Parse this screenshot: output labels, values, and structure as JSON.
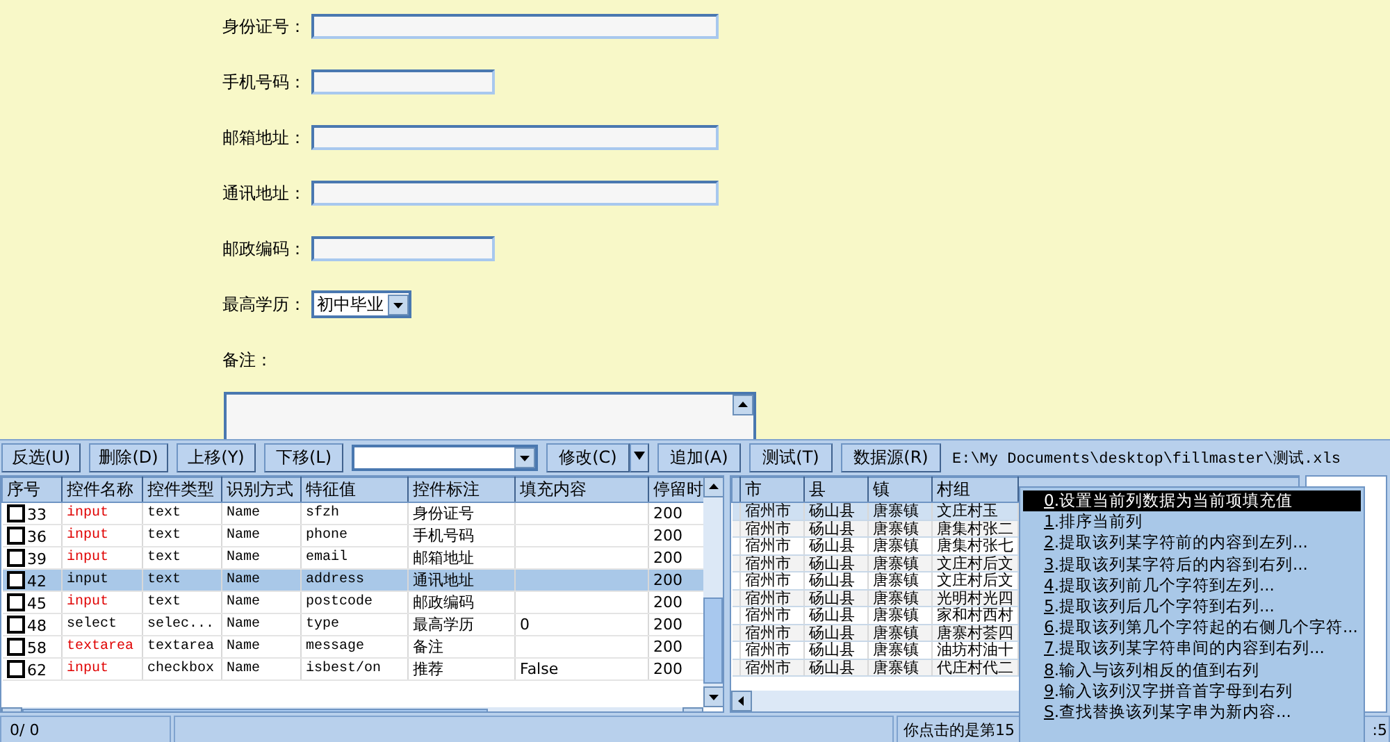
{
  "form": {
    "fields": [
      {
        "label": "身份证号：",
        "kind": "long_text"
      },
      {
        "label": "手机号码：",
        "kind": "short_text"
      },
      {
        "label": "邮箱地址：",
        "kind": "long_text"
      },
      {
        "label": "通讯地址：",
        "kind": "long_text"
      },
      {
        "label": "邮政编码：",
        "kind": "short_text"
      },
      {
        "label": "最高学历：",
        "kind": "select",
        "value": "初中毕业"
      },
      {
        "label": "备注：",
        "kind": "textarea"
      }
    ]
  },
  "toolbar": {
    "buttons": [
      {
        "text": "反选(U)"
      },
      {
        "text": "删除(D)"
      },
      {
        "text": "上移(Y)"
      },
      {
        "text": "下移(L)"
      }
    ],
    "button2": [
      {
        "text": "修改(C)",
        "dropdown": true
      },
      {
        "text": "追加(A)",
        "dropdown": false
      },
      {
        "text": "测试(T)",
        "dropdown": false
      },
      {
        "text": "数据源(R)",
        "dropdown": false
      }
    ],
    "path": "E:\\My Documents\\desktop\\fillmaster\\测试.xls"
  },
  "controls_table": {
    "columns": [
      "序号",
      "控件名称",
      "控件类型",
      "识别方式",
      "特征值",
      "控件标注",
      "填充内容",
      "停留时"
    ],
    "rows": [
      {
        "checked": false,
        "selected": false,
        "highlight": true,
        "cells": [
          "33",
          "input",
          "text",
          "Name",
          "sfzh",
          "身份证号",
          "",
          "200"
        ]
      },
      {
        "checked": false,
        "selected": false,
        "highlight": true,
        "cells": [
          "36",
          "input",
          "text",
          "Name",
          "phone",
          "手机号码",
          "",
          "200"
        ]
      },
      {
        "checked": false,
        "selected": false,
        "highlight": true,
        "cells": [
          "39",
          "input",
          "text",
          "Name",
          "email",
          "邮箱地址",
          "",
          "200"
        ]
      },
      {
        "checked": false,
        "selected": true,
        "highlight": false,
        "cells": [
          "42",
          "input",
          "text",
          "Name",
          "address",
          "通讯地址",
          "",
          "200"
        ]
      },
      {
        "checked": false,
        "selected": false,
        "highlight": true,
        "cells": [
          "45",
          "input",
          "text",
          "Name",
          "postcode",
          "邮政编码",
          "",
          "200"
        ]
      },
      {
        "checked": false,
        "selected": false,
        "highlight": false,
        "cells": [
          "48",
          "select",
          "selec...",
          "Name",
          "type",
          "最高学历",
          "0",
          "200"
        ]
      },
      {
        "checked": false,
        "selected": false,
        "highlight": true,
        "cells": [
          "58",
          "textarea",
          "textarea",
          "Name",
          "message",
          "备注",
          "",
          "200"
        ]
      },
      {
        "checked": false,
        "selected": false,
        "highlight": true,
        "cells": [
          "62",
          "input",
          "checkbox",
          "Name",
          "isbest/on",
          "推荐",
          "False",
          "200"
        ]
      }
    ]
  },
  "data_table": {
    "columns": [
      "市",
      "县",
      "镇",
      "村组"
    ],
    "rows": [
      {
        "selected": true,
        "cells": [
          "宿州市",
          "砀山县",
          "唐寨镇",
          "文庄村玉"
        ]
      },
      {
        "selected": false,
        "cells": [
          "宿州市",
          "砀山县",
          "唐寨镇",
          "唐集村张二"
        ]
      },
      {
        "selected": false,
        "cells": [
          "宿州市",
          "砀山县",
          "唐寨镇",
          "唐集村张七"
        ]
      },
      {
        "selected": false,
        "cells": [
          "宿州市",
          "砀山县",
          "唐寨镇",
          "文庄村后文"
        ]
      },
      {
        "selected": false,
        "cells": [
          "宿州市",
          "砀山县",
          "唐寨镇",
          "文庄村后文"
        ]
      },
      {
        "selected": false,
        "cells": [
          "宿州市",
          "砀山县",
          "唐寨镇",
          "光明村光四"
        ]
      },
      {
        "selected": false,
        "cells": [
          "宿州市",
          "砀山县",
          "唐寨镇",
          "家和村西村"
        ]
      },
      {
        "selected": false,
        "cells": [
          "宿州市",
          "砀山县",
          "唐寨镇",
          "唐寨村荟四"
        ]
      },
      {
        "selected": false,
        "cells": [
          "宿州市",
          "砀山县",
          "唐寨镇",
          "油坊村油十"
        ]
      },
      {
        "selected": false,
        "cells": [
          "宿州市",
          "砀山县",
          "唐寨镇",
          "代庄村代二"
        ]
      }
    ]
  },
  "context_menu": {
    "items": [
      {
        "key": "0",
        "text": ".设置当前列数据为当前项填充值",
        "selected": true
      },
      {
        "key": "1",
        "text": ".排序当前列",
        "selected": false
      },
      {
        "key": "2",
        "text": ".提取该列某字符前的内容到左列...",
        "selected": false
      },
      {
        "key": "3",
        "text": ".提取该列某字符后的内容到右列...",
        "selected": false
      },
      {
        "key": "4",
        "text": ".提取该列前几个字符到左列...",
        "selected": false
      },
      {
        "key": "5",
        "text": ".提取该列后几个字符到右列...",
        "selected": false
      },
      {
        "key": "6",
        "text": ".提取该列第几个字符起的右侧几个字符...",
        "selected": false
      },
      {
        "key": "7",
        "text": ".提取该列某字符串间的内容到右列...",
        "selected": false
      },
      {
        "key": "8",
        "text": ".输入与该列相反的值到右列",
        "selected": false
      },
      {
        "key": "9",
        "text": ".输入该列汉字拼音首字母到右列",
        "selected": false
      },
      {
        "key": "S",
        "text": ".查找替换该列某字串为新内容...",
        "selected": false
      }
    ]
  },
  "status_bar": {
    "count": "0/ 0",
    "message": "你点击的是第15",
    "right": ":5"
  }
}
